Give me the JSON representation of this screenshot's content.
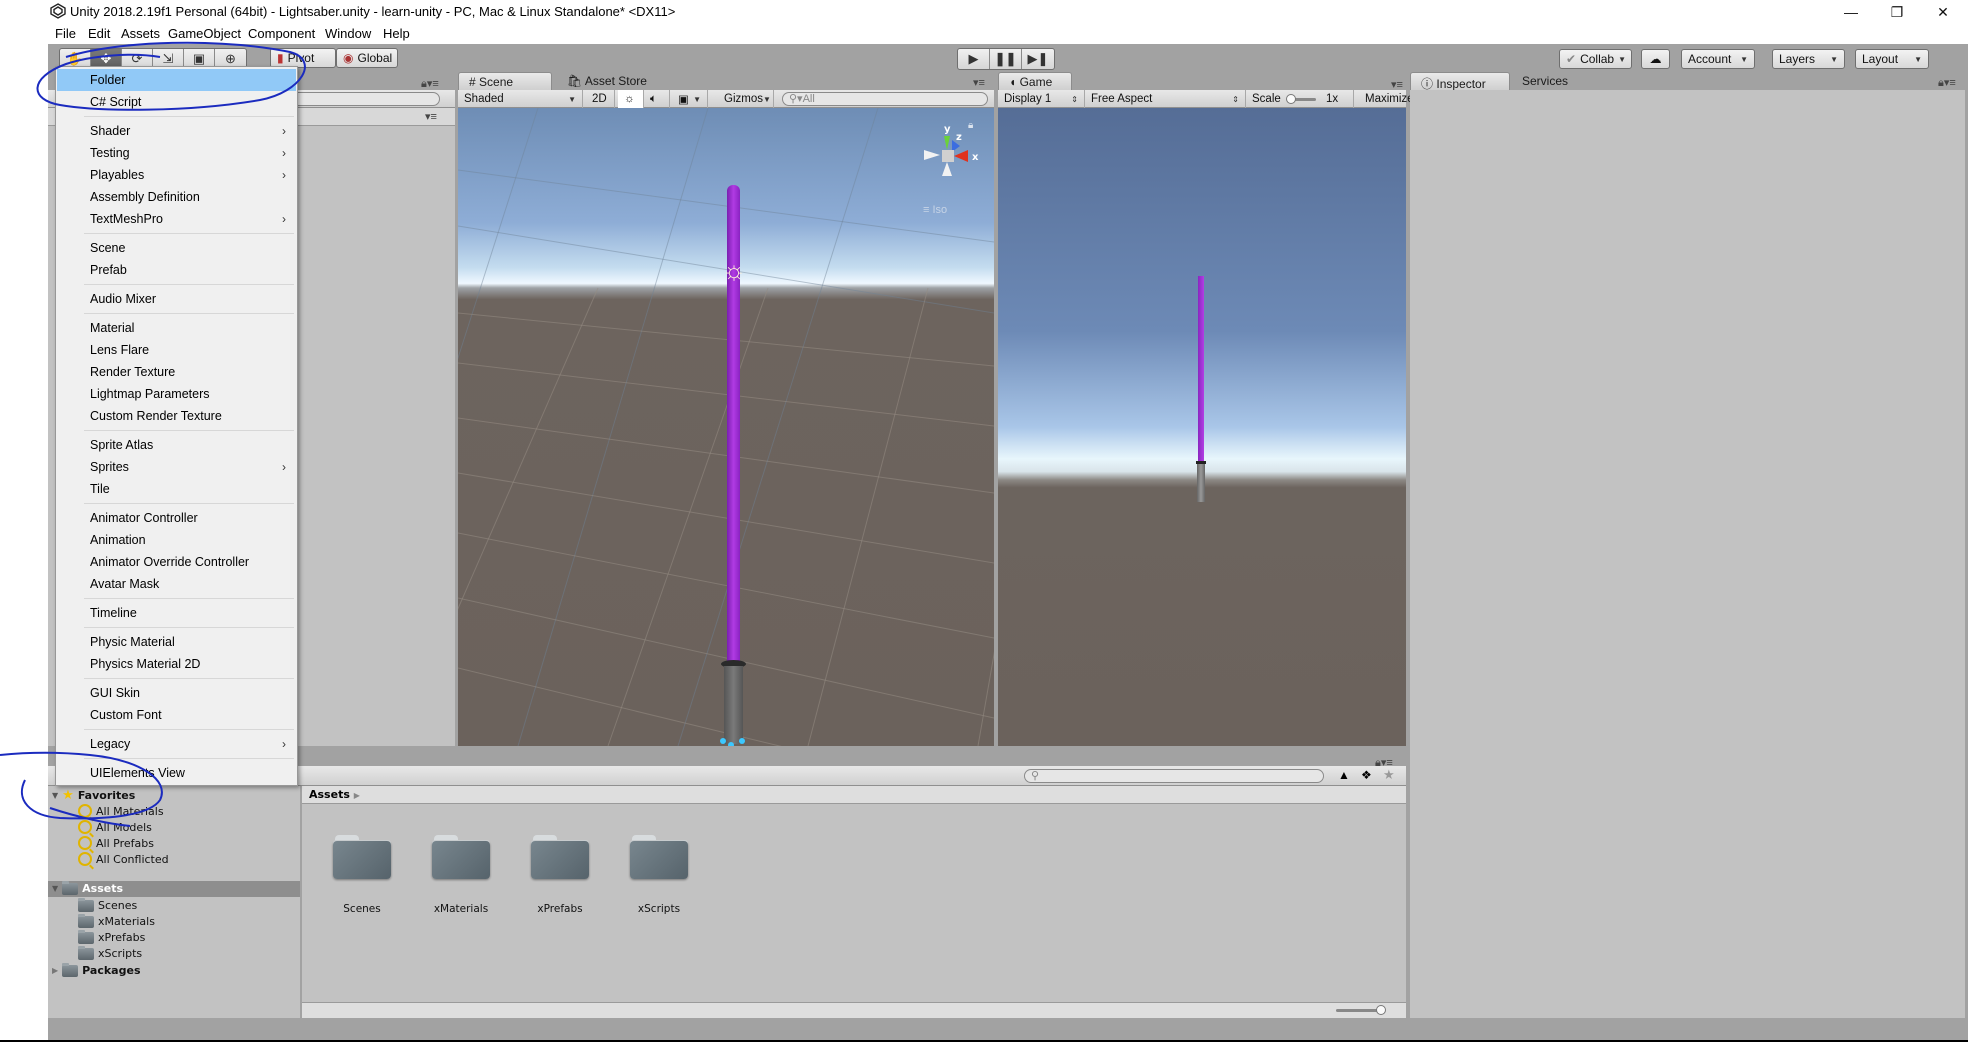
{
  "window": {
    "title": "Unity 2018.2.19f1 Personal (64bit) - Lightsaber.unity - learn-unity - PC, Mac & Linux Standalone* <DX11>",
    "controls": [
      "minimize",
      "restore",
      "close"
    ]
  },
  "menubar": [
    "File",
    "Edit",
    "Assets",
    "GameObject",
    "Component",
    "Window",
    "Help"
  ],
  "toolbar": {
    "transform_tools": [
      "hand-tool",
      "move-tool",
      "rotate-tool",
      "scale-tool",
      "rect-tool",
      "transform-tool"
    ],
    "active_tool": "move-tool",
    "pivot_label": "Pivot",
    "global_label": "Global",
    "play_controls": [
      "play",
      "pause",
      "step"
    ],
    "collab_label": "Collab",
    "account_label": "Account",
    "layers_label": "Layers",
    "layout_label": "Layout"
  },
  "scene_panel": {
    "tabs": [
      {
        "label": "Scene",
        "icon": "hash-icon",
        "active": true
      },
      {
        "label": "Asset Store",
        "icon": "store-icon",
        "active": false
      }
    ],
    "shading_mode": "Shaded",
    "mode_2d_label": "2D",
    "gizmos_label": "Gizmos",
    "search_placeholder": "All",
    "gizmo_axes": {
      "y": "y",
      "z": "z",
      "x": "x"
    },
    "projection_label": "Iso"
  },
  "game_panel": {
    "tab_label": "Game",
    "display": "Display 1",
    "aspect": "Free Aspect",
    "scale_label": "Scale",
    "scale_value": "1x",
    "maximize_label": "Maximize"
  },
  "inspector_panel": {
    "tabs": [
      {
        "label": "Inspector",
        "active": true
      },
      {
        "label": "Services",
        "active": false
      }
    ]
  },
  "context_menu": {
    "items": [
      {
        "label": "Folder",
        "highlighted": true,
        "submenu": false
      },
      {
        "label": "C# Script",
        "submenu": false
      },
      {
        "label": "Shader",
        "submenu": true
      },
      {
        "label": "Testing",
        "submenu": true
      },
      {
        "label": "Playables",
        "submenu": true
      },
      {
        "label": "Assembly Definition",
        "submenu": false
      },
      {
        "label": "TextMeshPro",
        "submenu": true
      },
      {
        "label": "Scene",
        "submenu": false
      },
      {
        "label": "Prefab",
        "submenu": false
      },
      {
        "label": "Audio Mixer",
        "submenu": false
      },
      {
        "label": "Material",
        "submenu": false
      },
      {
        "label": "Lens Flare",
        "submenu": false
      },
      {
        "label": "Render Texture",
        "submenu": false
      },
      {
        "label": "Lightmap Parameters",
        "submenu": false
      },
      {
        "label": "Custom Render Texture",
        "submenu": false
      },
      {
        "label": "Sprite Atlas",
        "submenu": false
      },
      {
        "label": "Sprites",
        "submenu": true
      },
      {
        "label": "Tile",
        "submenu": false
      },
      {
        "label": "Animator Controller",
        "submenu": false
      },
      {
        "label": "Animation",
        "submenu": false
      },
      {
        "label": "Animator Override Controller",
        "submenu": false
      },
      {
        "label": "Avatar Mask",
        "submenu": false
      },
      {
        "label": "Timeline",
        "submenu": false
      },
      {
        "label": "Physic Material",
        "submenu": false
      },
      {
        "label": "Physics Material 2D",
        "submenu": false
      },
      {
        "label": "GUI Skin",
        "submenu": false
      },
      {
        "label": "Custom Font",
        "submenu": false
      },
      {
        "label": "Legacy",
        "submenu": true
      },
      {
        "label": "UIElements View",
        "submenu": false
      }
    ]
  },
  "project_panel": {
    "favorites_label": "Favorites",
    "favorites": [
      "All Materials",
      "All Models",
      "All Prefabs",
      "All Conflicted"
    ],
    "assets_label": "Assets",
    "asset_folders": [
      "Scenes",
      "xMaterials",
      "xPrefabs",
      "xScripts"
    ],
    "packages_label": "Packages",
    "breadcrumb": "Assets",
    "grid_items": [
      "Scenes",
      "xMaterials",
      "xPrefabs",
      "xScripts"
    ]
  },
  "colors": {
    "menu_highlight": "#91c9f7",
    "editor_bg": "#a2a2a2",
    "panel_bg": "#c2c2c2",
    "saber_blade": "#9a2fd0",
    "annotation_ink": "#1b2bbf"
  }
}
